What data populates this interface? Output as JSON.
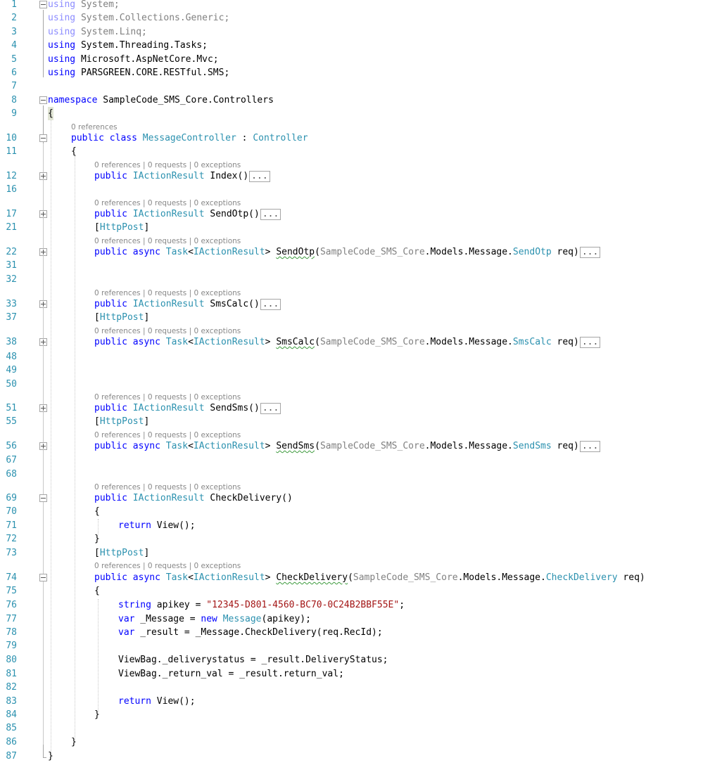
{
  "usings": [
    {
      "ln": "1",
      "kw": "using",
      "ns": "System;",
      "dim": true
    },
    {
      "ln": "2",
      "kw": "using",
      "ns": "System.Collections.Generic;",
      "dim": true
    },
    {
      "ln": "3",
      "kw": "using",
      "ns": "System.Linq;",
      "dim": true
    },
    {
      "ln": "4",
      "kw": "using",
      "ns": "System.Threading.Tasks;",
      "dim": false
    },
    {
      "ln": "5",
      "kw": "using",
      "ns": "Microsoft.AspNetCore.Mvc;",
      "dim": false
    },
    {
      "ln": "6",
      "kw": "using",
      "ns": "PARSGREEN.CORE.RESTful.SMS;",
      "dim": false
    }
  ],
  "lens_text": "0 references | 0 requests | 0 exceptions",
  "class_lens": "0 references",
  "line_numbers": {
    "l7": "7",
    "l8": "8",
    "l9": "9",
    "l10": "10",
    "l11": "11",
    "l12": "12",
    "l16": "16",
    "l17": "17",
    "l21": "21",
    "l22": "22",
    "l31": "31",
    "l32": "32",
    "l33": "33",
    "l37": "37",
    "l38": "38",
    "l48": "48",
    "l49": "49",
    "l50": "50",
    "l51": "51",
    "l55": "55",
    "l56": "56",
    "l67": "67",
    "l68": "68",
    "l69": "69",
    "l70": "70",
    "l71": "71",
    "l72": "72",
    "l73": "73",
    "l74": "74",
    "l75": "75",
    "l76": "76",
    "l77": "77",
    "l78": "78",
    "l79": "79",
    "l80": "80",
    "l81": "81",
    "l82": "82",
    "l83": "83",
    "l84": "84",
    "l85": "85",
    "l86": "86",
    "l87": "87"
  },
  "code": {
    "namespace_kw": "namespace",
    "namespace_name": "SampleCode_SMS_Core.Controllers",
    "open_brace": "{",
    "close_brace": "}",
    "public": "public",
    "class": "class",
    "async": "async",
    "class_name": "MessageController",
    "colon": " : ",
    "base_class": "Controller",
    "iaction": "IActionResult",
    "task": "Task",
    "lt": "<",
    "gt": ">",
    "index": "Index()",
    "send_otp": "SendOtp",
    "sms_calc": "SmsCalc",
    "send_sms": "SendSms",
    "check_delivery": "CheckDelivery",
    "parens": "()",
    "ellipsis": "...",
    "http_post_open": "[",
    "http_post": "HttpPost",
    "http_post_close": "]",
    "model_prefix": "SampleCode_SMS_Core",
    "model_mid": ".Models.Message.",
    "req": " req)",
    "paren_open": "(",
    "return": "return",
    "view_call": " View();",
    "string": "string",
    "apikey_decl": " apikey = ",
    "apikey_value": "\"12345-D801-4560-BC70-0C24B2BBF55E\"",
    "semi": ";",
    "var": "var",
    "message_decl": " _Message = ",
    "new": "new",
    "message_type": "Message",
    "message_args": "(apikey);",
    "result_decl": " _result = _Message.CheckDelivery(req.RecId);",
    "viewbag_status": "ViewBag._deliverystatus = _result.DeliveryStatus;",
    "viewbag_return": "ViewBag._return_val = _result.return_val;"
  }
}
